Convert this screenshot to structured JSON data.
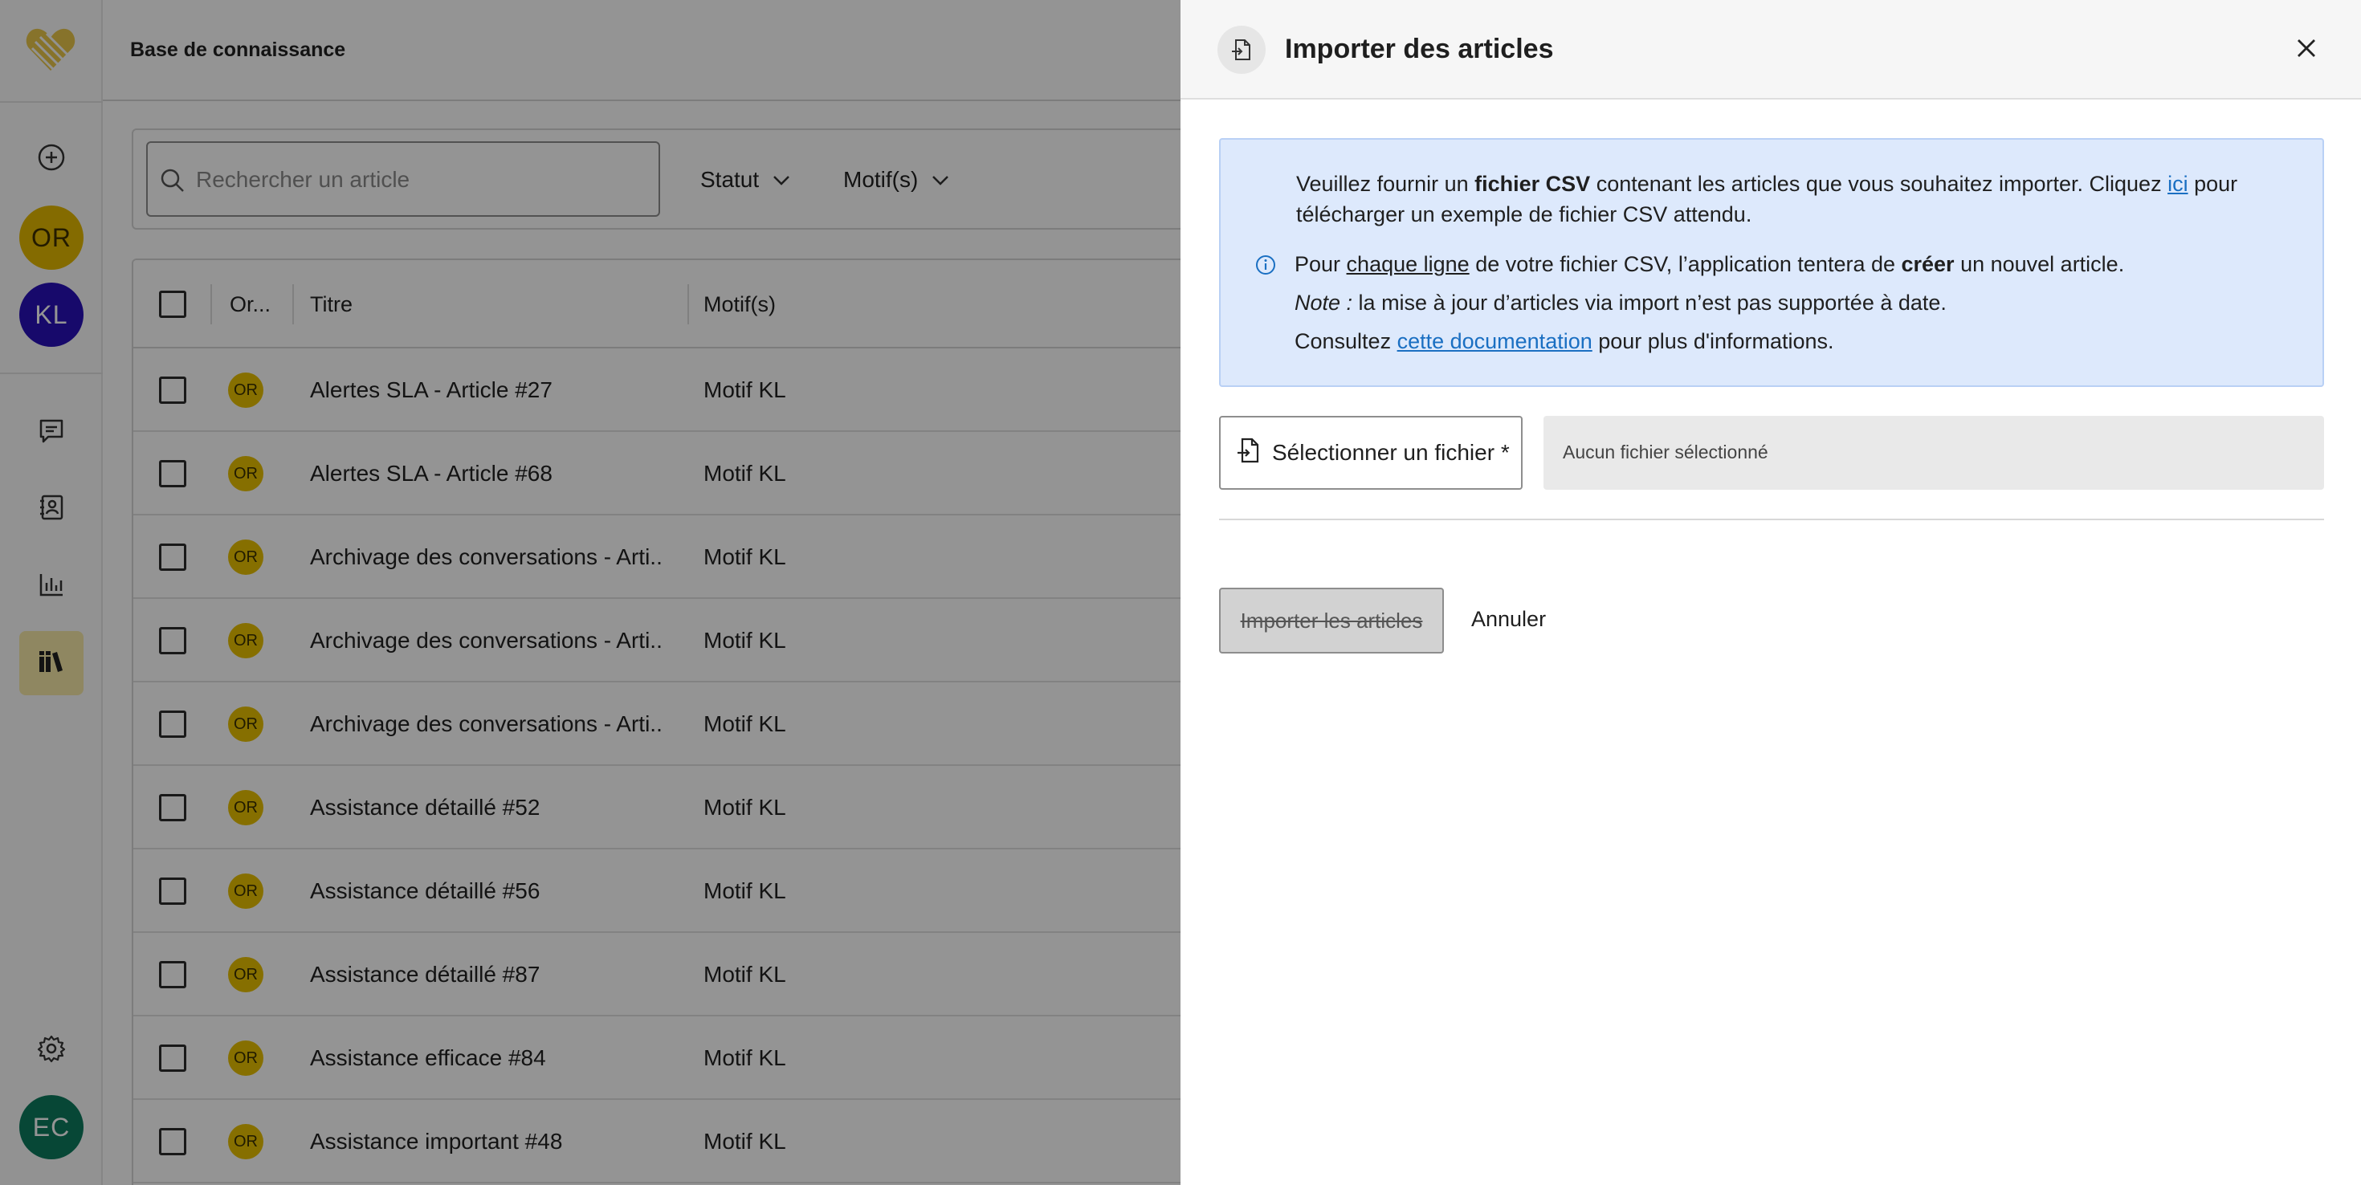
{
  "app": {
    "page_title": "Base de connaissance"
  },
  "rail": {
    "avatars": [
      {
        "initials": "OR",
        "bg": "#e3b800",
        "fg": "#3d3000"
      },
      {
        "initials": "KL",
        "bg": "#2811b8",
        "fg": "#ffffff"
      }
    ],
    "user": {
      "initials": "EC",
      "bg": "#0d7a5e",
      "fg": "#ffffff"
    },
    "icons": [
      "plus-circle-icon",
      "chat-icon",
      "contact-card-icon",
      "bar-chart-icon",
      "library-icon",
      "gear-icon"
    ],
    "active_item": "library-icon"
  },
  "filters": {
    "search_placeholder": "Rechercher un article",
    "status_label": "Statut",
    "motifs_label": "Motif(s)"
  },
  "table": {
    "headers": {
      "origin": "Or...",
      "title": "Titre",
      "motifs": "Motif(s)"
    },
    "rows": [
      {
        "origin": "OR",
        "title": "Alertes SLA - Article #27",
        "motif": "Motif KL"
      },
      {
        "origin": "OR",
        "title": "Alertes SLA - Article #68",
        "motif": "Motif KL"
      },
      {
        "origin": "OR",
        "title": "Archivage des conversations - Arti...",
        "motif": "Motif KL"
      },
      {
        "origin": "OR",
        "title": "Archivage des conversations - Arti...",
        "motif": "Motif KL"
      },
      {
        "origin": "OR",
        "title": "Archivage des conversations - Arti...",
        "motif": "Motif KL"
      },
      {
        "origin": "OR",
        "title": "Assistance détaillé #52",
        "motif": "Motif KL"
      },
      {
        "origin": "OR",
        "title": "Assistance détaillé #56",
        "motif": "Motif KL"
      },
      {
        "origin": "OR",
        "title": "Assistance détaillé #87",
        "motif": "Motif KL"
      },
      {
        "origin": "OR",
        "title": "Assistance efficace #84",
        "motif": "Motif KL"
      },
      {
        "origin": "OR",
        "title": "Assistance important #48",
        "motif": "Motif KL"
      }
    ]
  },
  "drawer": {
    "title": "Importer des articles",
    "info": {
      "l1_a": "Veuillez fournir un ",
      "l1_b": "fichier CSV",
      "l1_c": " contenant les articles que vous souhaitez importer. Cliquez ",
      "l1_link": "ici",
      "l1_d": " pour",
      "l2": "télécharger un exemple de fichier CSV attendu.",
      "l3_a": "Pour ",
      "l3_u": "chaque ligne",
      "l3_b": " de votre fichier CSV, l’application tentera de ",
      "l3_bold": "créer",
      "l3_c": " un nouvel article.",
      "l4_italic": "Note :",
      "l4_rest": " la mise à jour d’articles via import n’est pas supportée à date.",
      "l5_a": "Consultez ",
      "l5_link": "cette documentation",
      "l5_b": " pour plus d'informations."
    },
    "file_button": "Sélectionner un fichier *",
    "file_status": "Aucun fichier sélectionné",
    "import_button": "Importer les articles",
    "cancel_button": "Annuler"
  }
}
